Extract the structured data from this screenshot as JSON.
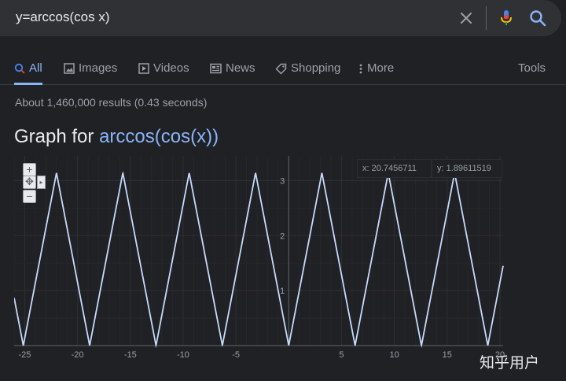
{
  "search": {
    "query": "y=arccos(cos x)",
    "clear_icon": "close-icon",
    "mic_icon": "mic-icon",
    "search_icon": "search-icon"
  },
  "tabs": {
    "items": [
      {
        "label": "All",
        "icon": "search-icon",
        "active": true
      },
      {
        "label": "Images",
        "icon": "image-icon",
        "active": false
      },
      {
        "label": "Videos",
        "icon": "play-icon",
        "active": false
      },
      {
        "label": "News",
        "icon": "news-icon",
        "active": false
      },
      {
        "label": "Shopping",
        "icon": "tag-icon",
        "active": false
      },
      {
        "label": "More",
        "icon": "more-vert-icon",
        "active": false
      }
    ],
    "tools_label": "Tools"
  },
  "results": {
    "stats": "About 1,460,000 results (0.43 seconds)"
  },
  "graph": {
    "title_prefix": "Graph for",
    "title_function": "arccos(cos(x))",
    "readout_x": "x: 20.7456711",
    "readout_y": "y: 1.89611519",
    "zoom_in_label": "+",
    "zoom_out_label": "−",
    "pan_label": "✥",
    "pan_arrow_label": "▸"
  },
  "chart_data": {
    "type": "line",
    "function": "arccos(cos(x))",
    "xlim": [
      -26,
      20.3
    ],
    "ylim": [
      0,
      3.45
    ],
    "x_ticks": [
      -25,
      -20,
      -15,
      -10,
      -5,
      5,
      10,
      15,
      20
    ],
    "y_ticks": [
      1,
      2,
      3
    ],
    "grid": true,
    "series": [
      {
        "color": "#c6dafc"
      }
    ]
  },
  "watermark": "知乎用户",
  "colors": {
    "background": "#202124",
    "search_bar": "#303134",
    "accent": "#8ab4f8",
    "plot_line": "#c6dafc"
  }
}
